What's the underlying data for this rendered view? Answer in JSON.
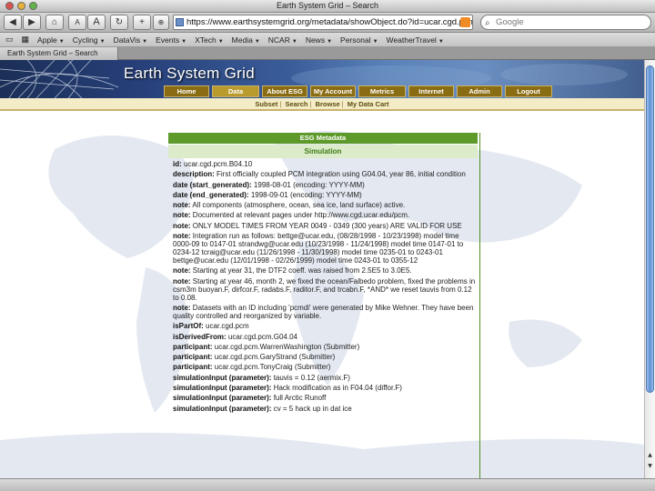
{
  "window": {
    "title": "Earth System Grid – Search"
  },
  "toolbar": {
    "back": "◀",
    "forward": "▶",
    "home": "⌂",
    "font_smaller": "A",
    "font_larger": "A",
    "reload": "↻",
    "new_tab": "+",
    "url": "https://www.earthsystemgrid.org/metadata/showObject.do?id=ucar.cgd.pcm.B",
    "search_placeholder": "Google"
  },
  "bookmarks": [
    {
      "label": "Apple"
    },
    {
      "label": "Cycling"
    },
    {
      "label": "DataVis"
    },
    {
      "label": "Events"
    },
    {
      "label": "XTech"
    },
    {
      "label": "Media"
    },
    {
      "label": "NCAR"
    },
    {
      "label": "News"
    },
    {
      "label": "Personal"
    },
    {
      "label": "WeatherTravel"
    }
  ],
  "tab": {
    "label": "Earth System Grid – Search"
  },
  "site": {
    "title": "Earth System Grid",
    "nav": [
      "Home",
      "Data",
      "About ESG",
      "My Account",
      "Metrics",
      "Internet",
      "Admin",
      "Logout"
    ],
    "subnav": [
      "Subset",
      "Search",
      "Browse",
      "My Data Cart"
    ]
  },
  "metadata": {
    "header": "ESG Metadata",
    "section": "Simulation",
    "fields": [
      {
        "k": "id:",
        "v": "ucar.cgd.pcm.B04.10"
      },
      {
        "k": "description:",
        "v": "First officially coupled PCM integration using G04.04, year 86, initial condition"
      },
      {
        "k": "date (start_generated):",
        "v": "1998-08-01 (encoding: YYYY-MM)"
      },
      {
        "k": "date (end_generated):",
        "v": "1998-09-01 (encoding: YYYY-MM)"
      },
      {
        "k": "note:",
        "v": "All components (atmosphere, ocean, sea ice, land surface) active."
      },
      {
        "k": "note:",
        "v": "Documented at relevant pages under http://www.cgd.ucar.edu/pcm."
      },
      {
        "k": "note:",
        "v": "ONLY MODEL TIMES FROM YEAR 0049 - 0349 (300 years) ARE VALID FOR USE"
      },
      {
        "k": "note:",
        "v": "Integration run as follows: bettge@ucar.edu, (08/28/1998 - 10/23/1998) model time 0000-09 to 0147-01 strandwg@ucar.edu (10/23/1998 - 11/24/1998) model time 0147-01 to 0234-12 tcraig@ucar.edu (11/26/1998 - 11/30/1998) model time 0235-01 to 0243-01 bettge@ucar.edu (12/01/1998 - 02/26/1999) model time 0243-01 to 0355-12"
      },
      {
        "k": "note:",
        "v": "Starting at year 31, the DTF2 coeff. was raised from 2.5E5 to 3.0E5."
      },
      {
        "k": "note:",
        "v": "Starting at year 46, month 2, we fixed the ocean/Falbedo problem, fixed the problems in csm3m buoyan.F, dirfcor.F, radabs.F, raditor.F, and trcabn.F, *AND* we reset tauvis from 0.12 to 0.08."
      },
      {
        "k": "note:",
        "v": "Datasets with an ID including 'pcmdi' were generated by Mike Wehner. They have been quality controlled and reorganized by variable."
      },
      {
        "k": "isPartOf:",
        "v": "ucar.cgd.pcm"
      },
      {
        "k": "isDerivedFrom:",
        "v": "ucar.cgd.pcm.G04.04"
      },
      {
        "k": "participant:",
        "v": "ucar.cgd.pcm.WarrenWashington (Submitter)"
      },
      {
        "k": "participant:",
        "v": "ucar.cgd.pcm.GaryStrand (Submitter)"
      },
      {
        "k": "participant:",
        "v": "ucar.cgd.pcm.TonyCraig (Submitter)"
      },
      {
        "k": "simulationInput (parameter):",
        "v": "tauvis = 0.12 (aermix.F)"
      },
      {
        "k": "simulationInput (parameter):",
        "v": "Hack modification as in F04.04 (diffor.F)"
      },
      {
        "k": "simulationInput (parameter):",
        "v": "full Arctic Runoff"
      },
      {
        "k": "simulationInput (parameter):",
        "v": "cv = 5 hack up in dat ice"
      }
    ]
  },
  "colors": {
    "nav_bg": "#8a6c12",
    "meta_header": "#5d9a2a",
    "meta_sub": "#dcebc9",
    "banner": "#27407a"
  }
}
